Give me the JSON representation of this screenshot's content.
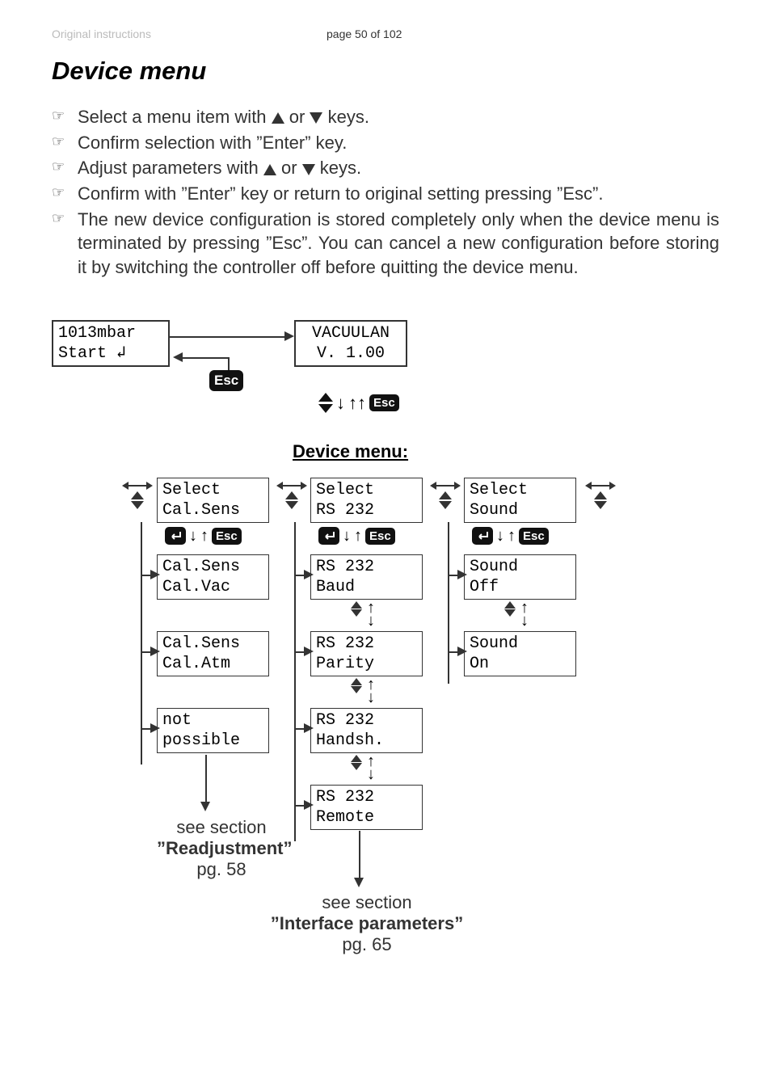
{
  "header": {
    "left": "Original instructions",
    "center": "page 50 of 102"
  },
  "title": "Device menu",
  "instructions": [
    {
      "pre": "Select a menu item with ",
      "mid": " or ",
      "post": " keys.",
      "arrows": true
    },
    {
      "text": "Confirm selection with ”Enter” key."
    },
    {
      "pre": "Adjust parameters with ",
      "mid": " or ",
      "post": " keys.",
      "arrows": true
    },
    {
      "text": "Confirm with ”Enter” key or return to original setting pressing ”Esc”."
    },
    {
      "text": "The new device configuration is stored completely only when the device menu is terminated by pressing ”Esc”. You can cancel a new configuration before storing it by switching the controller off before quitting the device menu."
    }
  ],
  "diagram": {
    "startBox": "1013mbar\nStart",
    "vacBox": "VACUULAN\nV. 1.00",
    "esc": "Esc",
    "menuTitle": "Device menu:",
    "col1": {
      "select": "Select\nCal.Sens",
      "a": "Cal.Sens\nCal.Vac",
      "b": "Cal.Sens\nCal.Atm",
      "c": "not\npossible",
      "ref_see": "see section",
      "ref_title": "”Readjustment”",
      "ref_pg": "pg. 58"
    },
    "col2": {
      "select": "Select\nRS 232",
      "a": "RS 232\nBaud",
      "b": "RS 232\nParity",
      "c": "RS 232\nHandsh.",
      "d": "RS 232\nRemote",
      "ref_see": "see section",
      "ref_title": "”Interface parameters”",
      "ref_pg": "pg.  65"
    },
    "col3": {
      "select": "Select\nSound",
      "a": "Sound\nOff",
      "b": "Sound\nOn"
    }
  }
}
